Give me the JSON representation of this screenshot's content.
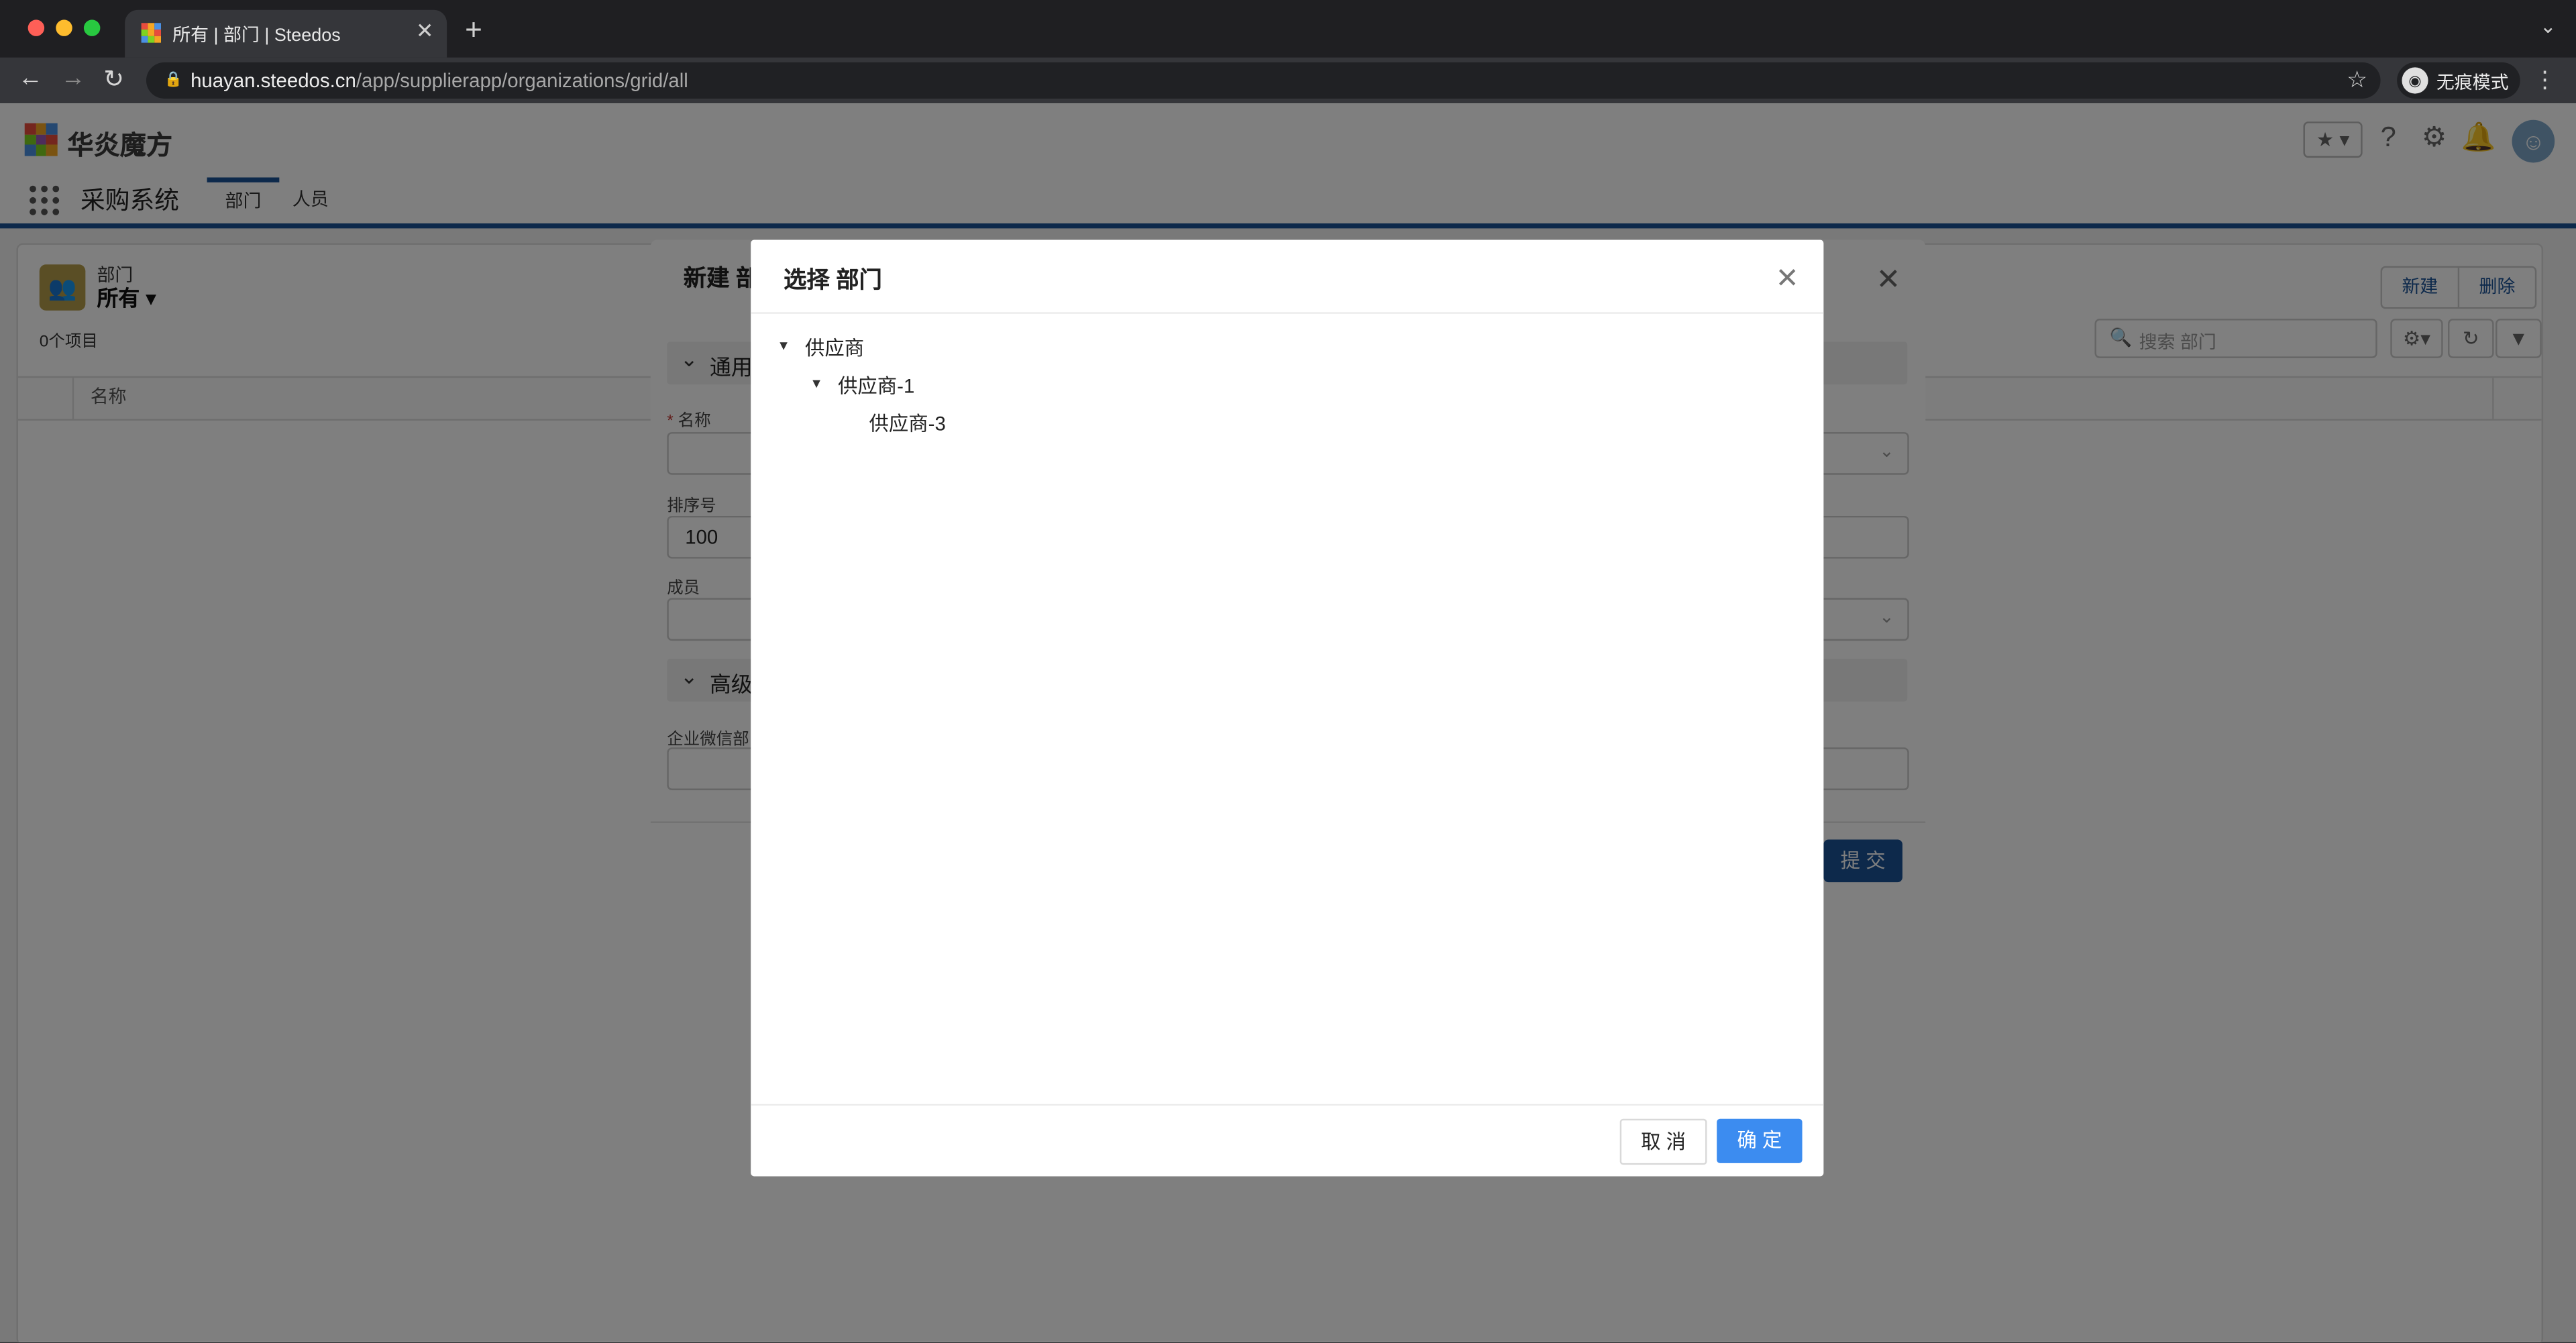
{
  "browser": {
    "tab_title": "所有 | 部门 | Steedos",
    "url_host": "huayan.steedos.cn",
    "url_path": "/app/supplierapp/organizations/grid/all",
    "incognito_label": "无痕模式"
  },
  "header": {
    "brand": "华炎魔方",
    "app_name": "采购系统"
  },
  "nav": {
    "tabs": [
      {
        "label": "部门",
        "active": true
      },
      {
        "label": "人员",
        "active": false
      }
    ]
  },
  "list": {
    "object_label": "部门",
    "view_name": "所有",
    "item_count": "0个项目",
    "new_label": "新建",
    "delete_label": "删除",
    "search_placeholder": "搜索 部门",
    "column_name": "名称"
  },
  "new_modal": {
    "title": "新建 部",
    "section_general": "通用",
    "field_name_label": "名称",
    "field_sort_label": "排序号",
    "field_sort_value": "100",
    "field_members_label": "成员",
    "section_advanced": "高级",
    "field_wechat_label": "企业微信部",
    "submit_label": "提 交"
  },
  "dialog": {
    "title": "选择 部门",
    "tree": [
      {
        "label": "供应商",
        "level": 0,
        "expanded": true
      },
      {
        "label": "供应商-1",
        "level": 1,
        "expanded": true
      },
      {
        "label": "供应商-3",
        "level": 2,
        "expanded": false
      }
    ],
    "cancel_label": "取 消",
    "ok_label": "确 定"
  },
  "colors": {
    "brand_blue": "#1b5297",
    "primary_button": "#3c8cf0",
    "object_icon": "#b59c4b"
  }
}
